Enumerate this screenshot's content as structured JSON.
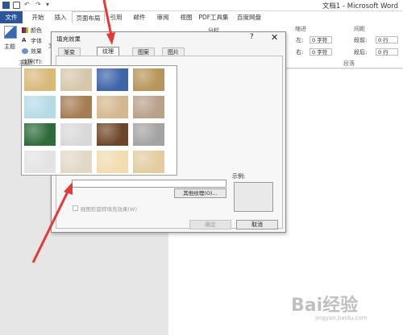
{
  "window": {
    "title": "文档1 - Microsoft Word"
  },
  "tabs": [
    "文件",
    "开始",
    "插入",
    "页面布局",
    "引用",
    "邮件",
    "审阅",
    "视图",
    "PDF工具集",
    "百度网盘"
  ],
  "ribbon": {
    "theme_label": "主题",
    "colors_label": "颜色",
    "fonts_label": "字体",
    "effects_label": "效果",
    "theme_group": "主题",
    "text_partial": "文字",
    "columns_label": "分栏",
    "indent_label": "缩进",
    "spacing_label": "间距",
    "left_label": "左:",
    "right_label": "右:",
    "left_value": "0 字符",
    "right_value": "0 字符",
    "before_label": "段前:",
    "after_label": "段后:",
    "before_value": "0 行",
    "after_value": "0 行",
    "paragraph_group": "段落"
  },
  "dialog": {
    "title": "填充效果",
    "help": "?",
    "close": "✕",
    "tabs": [
      "渐变",
      "纹理",
      "图案",
      "图片"
    ],
    "active_tab": "纹理",
    "texture_label": "纹理(T):",
    "textures": [
      {
        "name": "纸莎草纸",
        "color": "#d9b97a"
      },
      {
        "name": "画布",
        "color": "#d6c7ac"
      },
      {
        "name": "斜纹布",
        "color": "#3d63a8"
      },
      {
        "name": "编织物",
        "color": "#b8955a"
      },
      {
        "name": "水滴",
        "color": "#b7dbe6"
      },
      {
        "name": "纸袋",
        "color": "#a67c52"
      },
      {
        "name": "鱼类化石",
        "color": "#d4b78f"
      },
      {
        "name": "沙滩",
        "color": "#b9a18a"
      },
      {
        "name": "绿色大理石",
        "color": "#2e6a3a"
      },
      {
        "name": "白色大理石",
        "color": "#d9d9d9"
      },
      {
        "name": "褐色大理石",
        "color": "#6e4528"
      },
      {
        "name": "花岗岩",
        "color": "#a3a3a3"
      },
      {
        "name": "新闻纸",
        "color": "#e3e3e3"
      },
      {
        "name": "再生纸",
        "color": "#e2d8c6"
      },
      {
        "name": "羊皮纸",
        "color": "#f2dcb0"
      },
      {
        "name": "信纸",
        "color": "#e3cda0"
      }
    ],
    "other_texture_button": "其他纹理(O)...",
    "sample_label": "示例:",
    "rotate_label": "随图形旋转填充效果(W)",
    "ok_button": "确定",
    "cancel_button": "取消"
  },
  "watermark": {
    "text": "Bai经验",
    "sub": "jingyan.baidu.com"
  },
  "colors": {
    "accent": "#2b579a",
    "arrow": "#e53935"
  }
}
